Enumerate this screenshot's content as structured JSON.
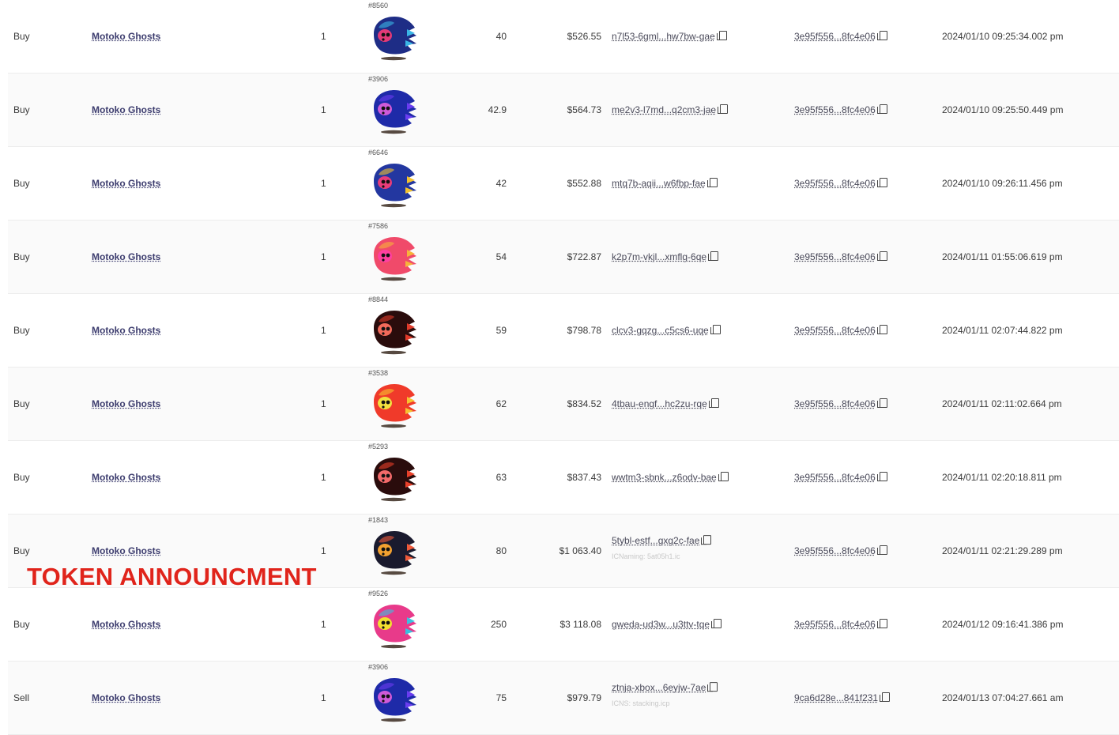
{
  "rows": [
    {
      "type": "Buy",
      "collection": "Motoko Ghosts",
      "qty": "1",
      "token_id": "#8560",
      "price": "40",
      "usd": "$526.55",
      "from": "n7l53-6gml...hw7bw-gae",
      "from_sub": "",
      "to": "3e95f556...8fc4e06",
      "date": "2024/01/10 09:25:34.002 pm",
      "ghost_colors": [
        "#1e2d86",
        "#3ab5e6",
        "#e23a78"
      ]
    },
    {
      "type": "Buy",
      "collection": "Motoko Ghosts",
      "qty": "1",
      "token_id": "#3906",
      "price": "42.9",
      "usd": "$564.73",
      "from": "me2v3-l7md...q2cm3-jae",
      "from_sub": "",
      "to": "3e95f556...8fc4e06",
      "date": "2024/01/10 09:25:50.449 pm",
      "ghost_colors": [
        "#1e2aa8",
        "#6a3cf0",
        "#d05ad8"
      ]
    },
    {
      "type": "Buy",
      "collection": "Motoko Ghosts",
      "qty": "1",
      "token_id": "#6646",
      "price": "42",
      "usd": "$552.88",
      "from": "mtq7b-aqii...w6fbp-fae",
      "from_sub": "",
      "to": "3e95f556...8fc4e06",
      "date": "2024/01/10 09:26:11.456 pm",
      "ghost_colors": [
        "#2337a0",
        "#f2c230",
        "#e83d7a"
      ]
    },
    {
      "type": "Buy",
      "collection": "Motoko Ghosts",
      "qty": "1",
      "token_id": "#7586",
      "price": "54",
      "usd": "$722.87",
      "from": "k2p7m-vkjl...xmflg-6qe",
      "from_sub": "",
      "to": "3e95f556...8fc4e06",
      "date": "2024/01/11 01:55:06.619 pm",
      "ghost_colors": [
        "#f04a6a",
        "#f7b23a",
        "#ff3fa0"
      ]
    },
    {
      "type": "Buy",
      "collection": "Motoko Ghosts",
      "qty": "1",
      "token_id": "#8844",
      "price": "59",
      "usd": "$798.78",
      "from": "clcv3-gqzg...c5cs6-uqe",
      "from_sub": "",
      "to": "3e95f556...8fc4e06",
      "date": "2024/01/11 02:07:44.822 pm",
      "ghost_colors": [
        "#2a0c0c",
        "#e03a2a",
        "#f26a5a"
      ]
    },
    {
      "type": "Buy",
      "collection": "Motoko Ghosts",
      "qty": "1",
      "token_id": "#3538",
      "price": "62",
      "usd": "$834.52",
      "from": "4tbau-engf...hc2zu-rqe",
      "from_sub": "",
      "to": "3e95f556...8fc4e06",
      "date": "2024/01/11 02:11:02.664 pm",
      "ghost_colors": [
        "#f03a2a",
        "#f7c230",
        "#f2e040"
      ]
    },
    {
      "type": "Buy",
      "collection": "Motoko Ghosts",
      "qty": "1",
      "token_id": "#5293",
      "price": "63",
      "usd": "$837.43",
      "from": "wwtm3-sbnk...z6odv-bae",
      "from_sub": "",
      "to": "3e95f556...8fc4e06",
      "date": "2024/01/11 02:20:18.811 pm",
      "ghost_colors": [
        "#2a0c0c",
        "#e8402a",
        "#f26a6a"
      ]
    },
    {
      "type": "Buy",
      "collection": "Motoko Ghosts",
      "qty": "1",
      "token_id": "#1843",
      "price": "80",
      "usd": "$1 063.40",
      "from": "5tybl-estf...gxg2c-fae",
      "from_sub": "ICNaming: 5at05h1.ic",
      "to": "3e95f556...8fc4e06",
      "date": "2024/01/11 02:21:29.289 pm",
      "ghost_colors": [
        "#1a1a2e",
        "#f05a3a",
        "#f2a030"
      ]
    },
    {
      "type": "Buy",
      "collection": "Motoko Ghosts",
      "qty": "1",
      "token_id": "#9526",
      "price": "250",
      "usd": "$3 118.08",
      "from": "gweda-ud3w...u3ttv-tqe",
      "from_sub": "",
      "to": "3e95f556...8fc4e06",
      "date": "2024/01/12 09:16:41.386 pm",
      "ghost_colors": [
        "#e83a8a",
        "#3ac0e0",
        "#f2e030"
      ]
    },
    {
      "type": "Sell",
      "collection": "Motoko Ghosts",
      "qty": "1",
      "token_id": "#3906",
      "price": "75",
      "usd": "$979.79",
      "from": "ztnja-xbox...6eyjw-7ae",
      "from_sub": "ICNS: stacking.icp",
      "to": "9ca6d28e...841f231",
      "date": "2024/01/13 07:04:27.661 am",
      "ghost_colors": [
        "#1e2aa8",
        "#6a3cf0",
        "#d05ad8"
      ]
    }
  ],
  "overlay": {
    "text": "TOKEN ANNOUNCMENT",
    "color": "#e0241b"
  }
}
